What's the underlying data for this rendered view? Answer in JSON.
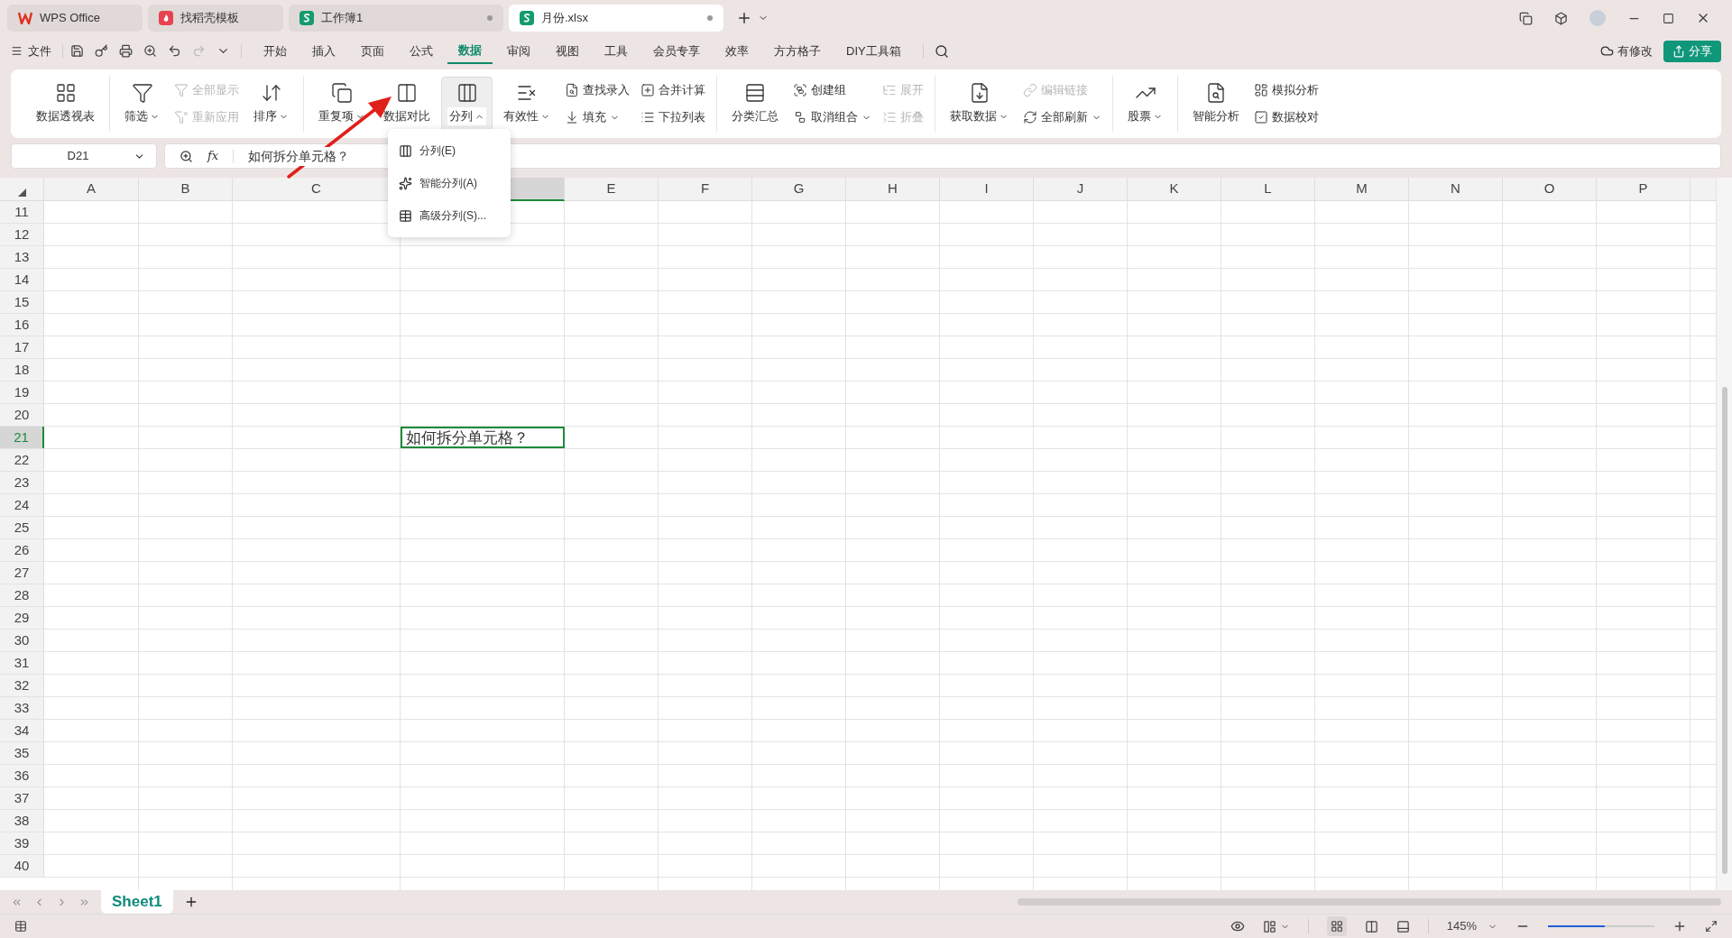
{
  "title_tabs": [
    {
      "label": "WPS Office",
      "kind": "home",
      "selected": false,
      "unsaved": false
    },
    {
      "label": "找稻壳模板",
      "kind": "template",
      "selected": false,
      "unsaved": false
    },
    {
      "label": "工作簿1",
      "kind": "sheet",
      "selected": false,
      "unsaved": true
    },
    {
      "label": "月份.xlsx",
      "kind": "sheet",
      "selected": true,
      "unsaved": true
    }
  ],
  "menu": {
    "file_label": "文件",
    "tabs": [
      {
        "label": "开始",
        "selected": false
      },
      {
        "label": "插入",
        "selected": false
      },
      {
        "label": "页面",
        "selected": false
      },
      {
        "label": "公式",
        "selected": false
      },
      {
        "label": "数据",
        "selected": true
      },
      {
        "label": "审阅",
        "selected": false
      },
      {
        "label": "视图",
        "selected": false
      },
      {
        "label": "工具",
        "selected": false
      },
      {
        "label": "会员专享",
        "selected": false
      },
      {
        "label": "效率",
        "selected": false
      },
      {
        "label": "方方格子",
        "selected": false
      },
      {
        "label": "DIY工具箱",
        "selected": false
      }
    ],
    "cloud_status": "有修改",
    "share_button": "分享"
  },
  "ribbon": {
    "groups": [
      {
        "items": [
          {
            "kind": "large",
            "label": "数据透视表",
            "has_menu": false,
            "disabled": false,
            "expanded": false
          }
        ]
      },
      {
        "items": [
          {
            "kind": "large",
            "label": "筛选",
            "has_menu": true,
            "disabled": false,
            "expanded": false
          },
          {
            "kind": "stack",
            "items": [
              {
                "label": "全部显示",
                "has_menu": false,
                "disabled": true
              },
              {
                "label": "重新应用",
                "has_menu": false,
                "disabled": true
              }
            ]
          },
          {
            "kind": "large",
            "label": "排序",
            "has_menu": true,
            "disabled": false,
            "expanded": false
          }
        ]
      },
      {
        "items": [
          {
            "kind": "large",
            "label": "重复项",
            "has_menu": true,
            "disabled": false,
            "expanded": false
          },
          {
            "kind": "large",
            "label": "数据对比",
            "has_menu": false,
            "disabled": false,
            "expanded": false
          },
          {
            "kind": "large",
            "label": "分列",
            "has_menu": true,
            "disabled": false,
            "expanded": true
          },
          {
            "kind": "large",
            "label": "有效性",
            "has_menu": true,
            "disabled": false,
            "expanded": false
          },
          {
            "kind": "stack",
            "items": [
              {
                "label": "查找录入",
                "has_menu": false,
                "disabled": false
              },
              {
                "label": "填充",
                "has_menu": true,
                "disabled": false
              }
            ]
          },
          {
            "kind": "stack",
            "items": [
              {
                "label": "合并计算",
                "has_menu": false,
                "disabled": false
              },
              {
                "label": "下拉列表",
                "has_menu": false,
                "disabled": false
              }
            ]
          }
        ]
      },
      {
        "items": [
          {
            "kind": "large",
            "label": "分类汇总",
            "has_menu": false,
            "disabled": false,
            "expanded": false
          },
          {
            "kind": "stack",
            "items": [
              {
                "label": "创建组",
                "has_menu": false,
                "disabled": false
              },
              {
                "label": "取消组合",
                "has_menu": true,
                "disabled": false
              }
            ]
          },
          {
            "kind": "stack",
            "items": [
              {
                "label": "展开",
                "has_menu": false,
                "disabled": true
              },
              {
                "label": "折叠",
                "has_menu": false,
                "disabled": true
              }
            ]
          }
        ]
      },
      {
        "items": [
          {
            "kind": "large",
            "label": "获取数据",
            "has_menu": true,
            "disabled": false,
            "expanded": false
          },
          {
            "kind": "stack",
            "items": [
              {
                "label": "编辑链接",
                "has_menu": false,
                "disabled": true
              },
              {
                "label": "全部刷新",
                "has_menu": true,
                "disabled": false
              }
            ]
          }
        ]
      },
      {
        "items": [
          {
            "kind": "large",
            "label": "股票",
            "has_menu": true,
            "disabled": false,
            "expanded": false
          }
        ]
      },
      {
        "items": [
          {
            "kind": "large",
            "label": "智能分析",
            "has_menu": false,
            "disabled": false,
            "expanded": false
          },
          {
            "kind": "stack",
            "items": [
              {
                "label": "模拟分析",
                "has_menu": false,
                "disabled": false
              },
              {
                "label": "数据校对",
                "has_menu": false,
                "disabled": false
              }
            ]
          }
        ]
      }
    ]
  },
  "dropdown": {
    "items": [
      {
        "label": "分列(E)"
      },
      {
        "label": "智能分列(A)"
      },
      {
        "label": "高级分列(S)..."
      }
    ]
  },
  "formula_bar": {
    "name_box": "D21",
    "function_label": "fx",
    "formula": "如何拆分单元格？"
  },
  "sheet": {
    "columns": [
      {
        "label": "A",
        "selected": false
      },
      {
        "label": "B",
        "selected": false
      },
      {
        "label": "C",
        "selected": false
      },
      {
        "selected": true
      },
      {
        "label": "E",
        "selected": false
      },
      {
        "label": "F",
        "selected": false
      },
      {
        "label": "G",
        "selected": false
      },
      {
        "label": "H",
        "selected": false
      },
      {
        "label": "I",
        "selected": false
      },
      {
        "label": "J",
        "selected": false
      },
      {
        "label": "K",
        "selected": false
      },
      {
        "label": "L",
        "selected": false
      },
      {
        "label": "M",
        "selected": false
      },
      {
        "label": "N",
        "selected": false
      },
      {
        "label": "O",
        "selected": false
      },
      {
        "label": "P",
        "selected": false
      }
    ],
    "rows": [
      {
        "label": "11",
        "selected": false
      },
      {
        "label": "12",
        "selected": false
      },
      {
        "label": "13",
        "selected": false
      },
      {
        "label": "14",
        "selected": false
      },
      {
        "label": "15",
        "selected": false
      },
      {
        "label": "16",
        "selected": false
      },
      {
        "label": "17",
        "selected": false
      },
      {
        "label": "18",
        "selected": false
      },
      {
        "label": "19",
        "selected": false
      },
      {
        "label": "20",
        "selected": false
      },
      {
        "label": "21",
        "selected": true
      },
      {
        "label": "22",
        "selected": false
      },
      {
        "label": "23",
        "selected": false
      },
      {
        "label": "24",
        "selected": false
      },
      {
        "label": "25",
        "selected": false
      },
      {
        "label": "26",
        "selected": false
      },
      {
        "label": "27",
        "selected": false
      },
      {
        "label": "28",
        "selected": false
      },
      {
        "label": "29",
        "selected": false
      },
      {
        "label": "30",
        "selected": false
      },
      {
        "label": "31",
        "selected": false
      },
      {
        "label": "32",
        "selected": false
      },
      {
        "label": "33",
        "selected": false
      },
      {
        "label": "34",
        "selected": false
      },
      {
        "label": "35",
        "selected": false
      },
      {
        "label": "36",
        "selected": false
      },
      {
        "label": "37",
        "selected": false
      },
      {
        "label": "38",
        "selected": false
      },
      {
        "label": "39",
        "selected": false
      },
      {
        "label": "40",
        "selected": false
      }
    ],
    "active_cell": {
      "text": "如何拆分单元格？"
    }
  },
  "sheet_tabs": [
    {
      "label": "Sheet1",
      "selected": true
    }
  ],
  "status_bar": {
    "zoom": "145%",
    "zoom_slider": {
      "level": 0.53
    }
  }
}
